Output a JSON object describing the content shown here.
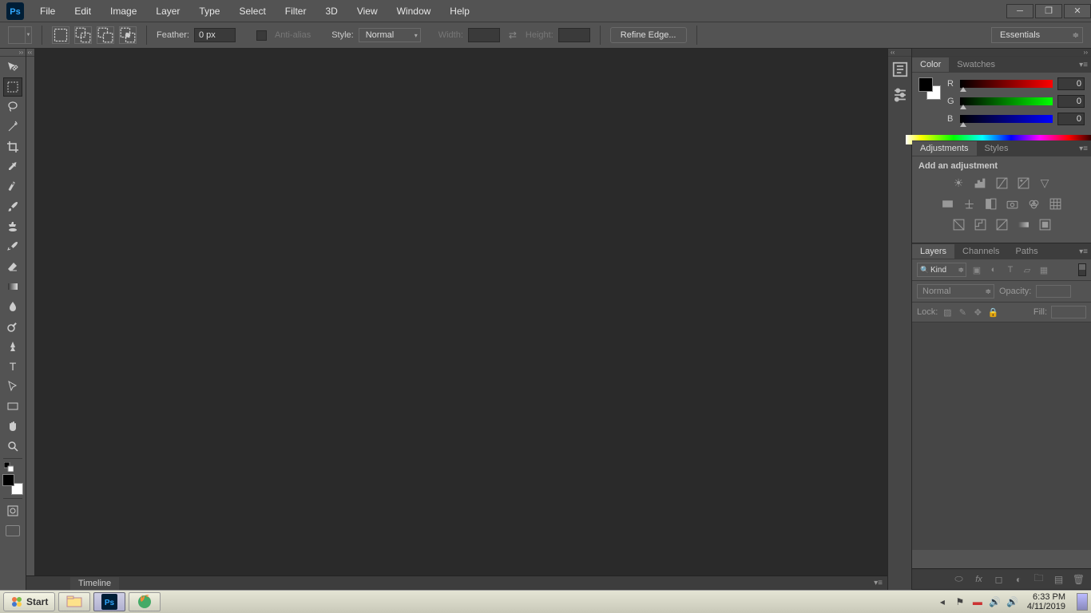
{
  "app": {
    "logo_text": "Ps"
  },
  "menu": [
    "File",
    "Edit",
    "Image",
    "Layer",
    "Type",
    "Select",
    "Filter",
    "3D",
    "View",
    "Window",
    "Help"
  ],
  "options": {
    "feather_label": "Feather:",
    "feather_value": "0 px",
    "antialias_label": "Anti-alias",
    "style_label": "Style:",
    "style_value": "Normal",
    "width_label": "Width:",
    "height_label": "Height:",
    "refine_btn": "Refine Edge...",
    "workspace": "Essentials"
  },
  "timeline": {
    "label": "Timeline"
  },
  "panels": {
    "color": {
      "tab_color": "Color",
      "tab_swatches": "Swatches",
      "r_label": "R",
      "g_label": "G",
      "b_label": "B",
      "r": "0",
      "g": "0",
      "b": "0"
    },
    "adjustments": {
      "tab_adjustments": "Adjustments",
      "tab_styles": "Styles",
      "add_label": "Add an adjustment"
    },
    "layers": {
      "tab_layers": "Layers",
      "tab_channels": "Channels",
      "tab_paths": "Paths",
      "kind": "Kind",
      "blend": "Normal",
      "opacity_label": "Opacity:",
      "lock_label": "Lock:",
      "fill_label": "Fill:"
    }
  },
  "taskbar": {
    "start": "Start",
    "time": "6:33 PM",
    "date": "4/11/2019"
  }
}
